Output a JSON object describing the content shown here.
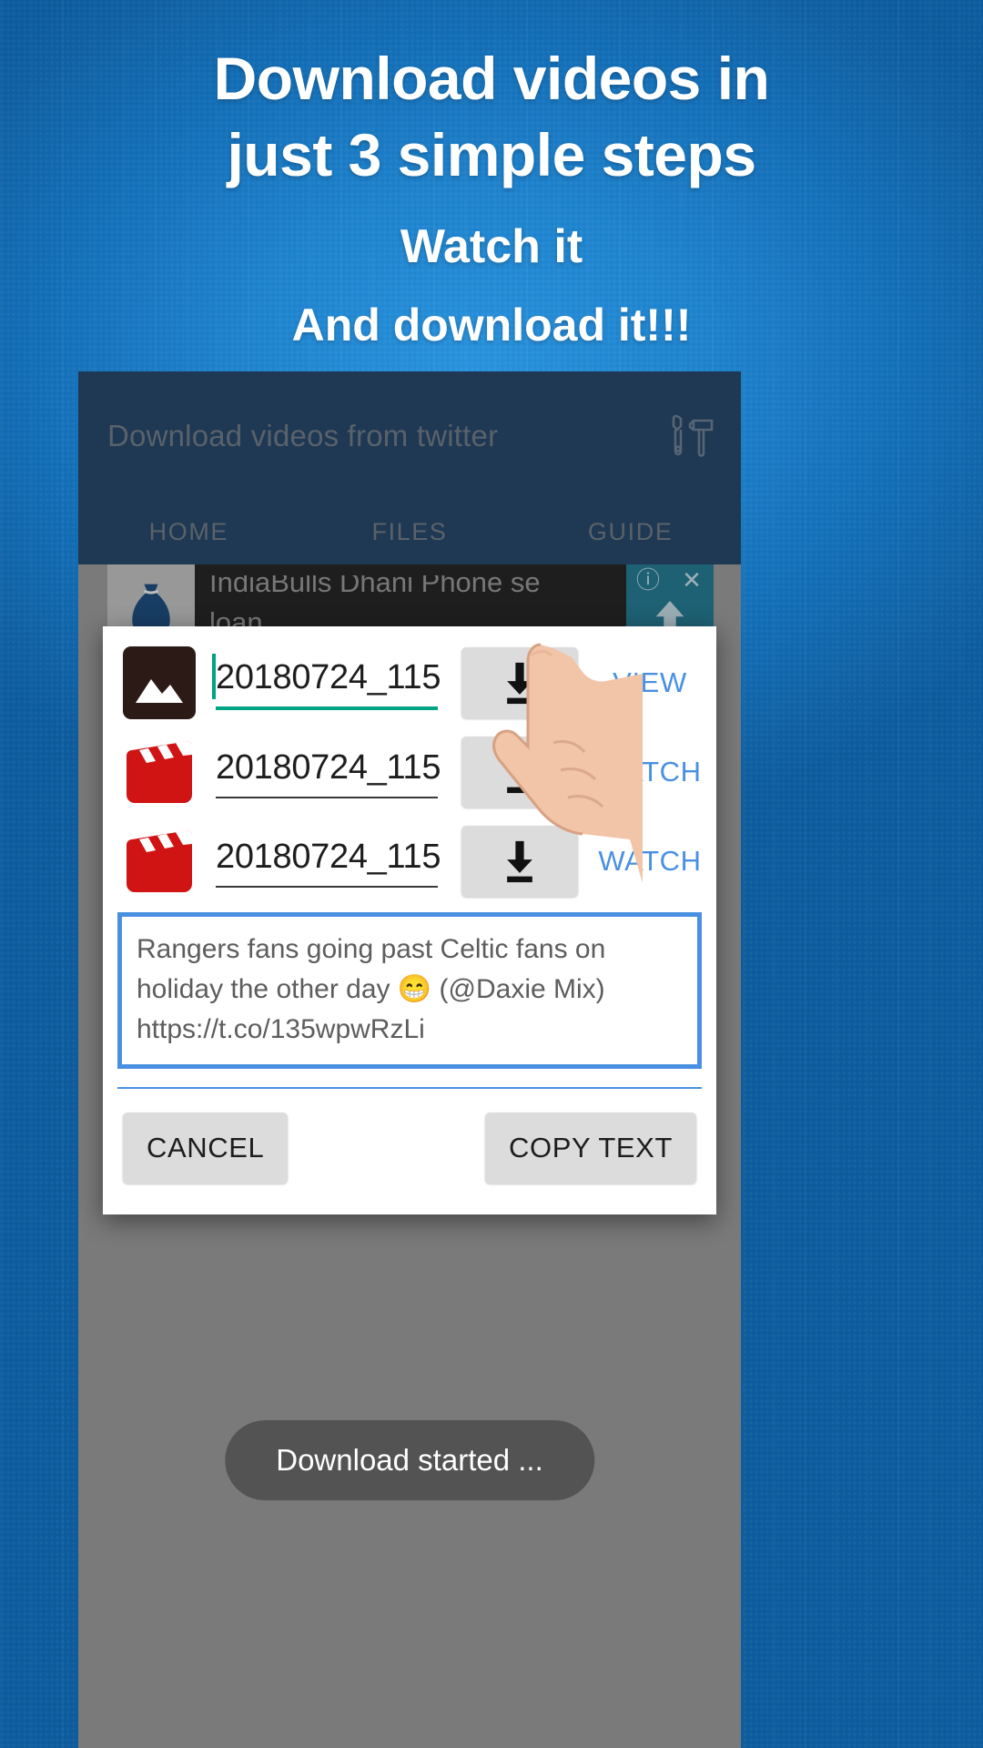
{
  "promo": {
    "line1": "Download  videos in",
    "line2": "just 3 simple steps",
    "line3": "Watch it",
    "line4": "And download it!!!"
  },
  "app": {
    "title": "Download videos from twitter",
    "tools_icon": "tools-wrench-hammer-icon",
    "tabs": [
      {
        "label": "HOME"
      },
      {
        "label": "FILES"
      },
      {
        "label": "GUIDE"
      }
    ]
  },
  "ad": {
    "headline": "IndiaBulls Dhani Phone se",
    "subline": "loan",
    "icon": "money-bag-icon",
    "info_badge": "ⓘ",
    "close_badge": "✕",
    "download_badge": "download-arrow-icon"
  },
  "dialog": {
    "rows": [
      {
        "icon": "image-file-icon",
        "filename": "20180724_115",
        "download_icon": "download-icon",
        "action": "VIEW",
        "focused": true
      },
      {
        "icon": "video-file-icon",
        "filename": "20180724_115",
        "download_icon": "download-icon",
        "action": "WATCH",
        "focused": false
      },
      {
        "icon": "video-file-icon",
        "filename": "20180724_115",
        "download_icon": "download-icon",
        "action": "WATCH",
        "focused": false
      }
    ],
    "tweet_text": "Rangers fans going past Celtic fans on\nholiday the other day 😁 (@Daxie Mix)\nhttps://t.co/135wpwRzLi",
    "cancel_label": "CANCEL",
    "copy_label": "COPY TEXT"
  },
  "toast": {
    "message": "Download started ..."
  },
  "colors": {
    "promo_bg": "#1877c0",
    "appbar": "#1c3f66",
    "link_blue": "#4a90e2",
    "focus_teal": "#00a383",
    "video_red": "#d01414",
    "button_grey": "#dcdcdc"
  }
}
